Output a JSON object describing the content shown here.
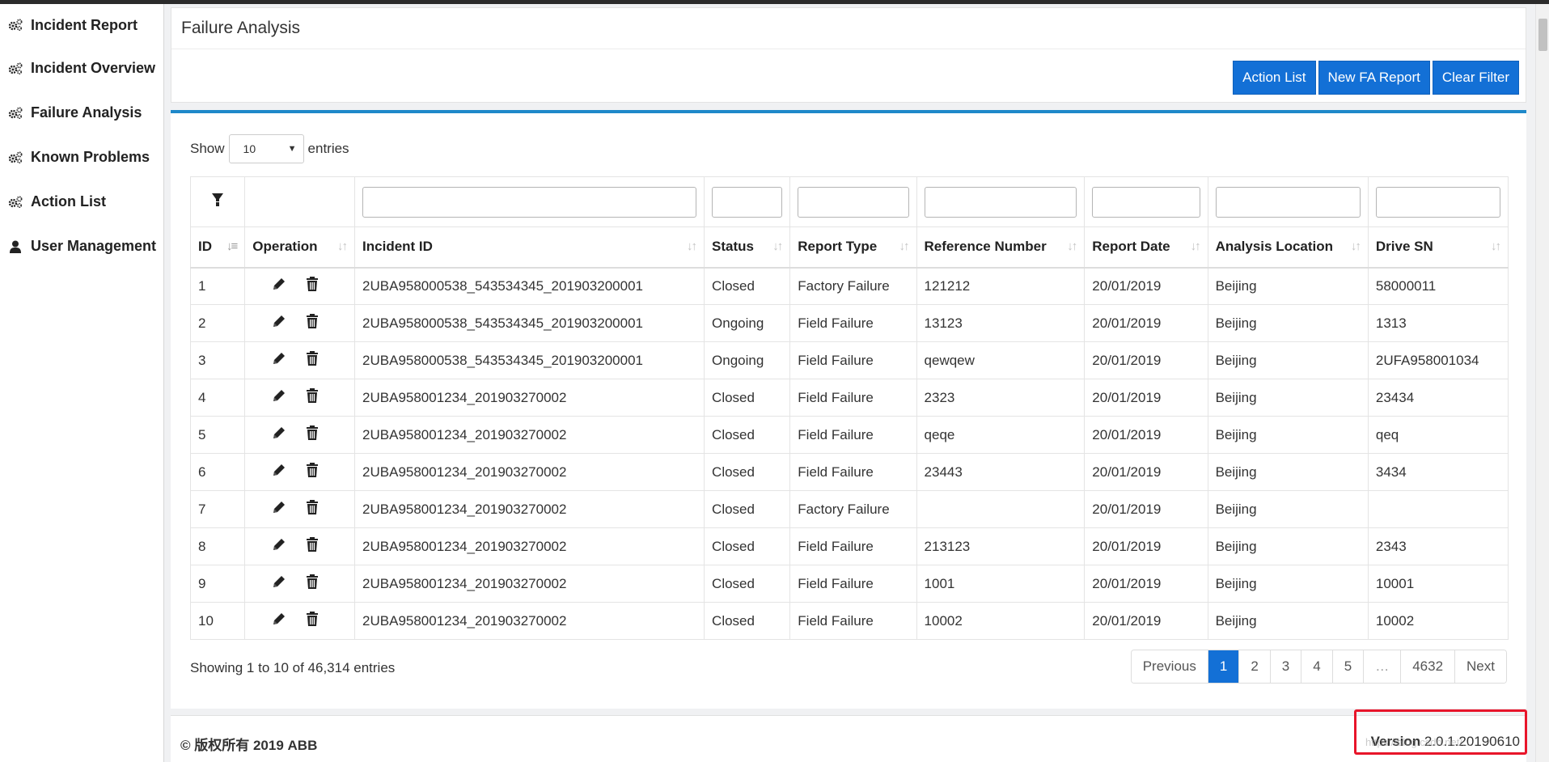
{
  "sidebar": {
    "items": [
      {
        "label": "Incident Report",
        "icon": "gears-icon"
      },
      {
        "label": "Incident Overview",
        "icon": "gears-icon"
      },
      {
        "label": "Failure Analysis",
        "icon": "gears-icon"
      },
      {
        "label": "Known Problems",
        "icon": "gears-icon"
      },
      {
        "label": "Action List",
        "icon": "gears-icon"
      },
      {
        "label": "User Management",
        "icon": "user-icon"
      }
    ]
  },
  "header": {
    "title": "Failure Analysis",
    "buttons": {
      "action_list": "Action List",
      "new_fa_report": "New FA Report",
      "clear_filter": "Clear Filter"
    }
  },
  "table": {
    "show_label": "Show",
    "page_size": "10",
    "entries_label": "entries",
    "columns": [
      "ID",
      "Operation",
      "Incident ID",
      "Status",
      "Report Type",
      "Reference Number",
      "Report Date",
      "Analysis Location",
      "Drive SN"
    ],
    "rows": [
      {
        "id": "1",
        "incident_id": "2UBA958000538_543534345_201903200001",
        "status": "Closed",
        "report_type": "Factory Failure",
        "reference": "121212",
        "date": "20/01/2019",
        "location": "Beijing",
        "drive_sn": "58000011"
      },
      {
        "id": "2",
        "incident_id": "2UBA958000538_543534345_201903200001",
        "status": "Ongoing",
        "report_type": "Field Failure",
        "reference": "13123",
        "date": "20/01/2019",
        "location": "Beijing",
        "drive_sn": "1313"
      },
      {
        "id": "3",
        "incident_id": "2UBA958000538_543534345_201903200001",
        "status": "Ongoing",
        "report_type": "Field Failure",
        "reference": "qewqew",
        "date": "20/01/2019",
        "location": "Beijing",
        "drive_sn": "2UFA958001034"
      },
      {
        "id": "4",
        "incident_id": "2UBA958001234_201903270002",
        "status": "Closed",
        "report_type": "Field Failure",
        "reference": "2323",
        "date": "20/01/2019",
        "location": "Beijing",
        "drive_sn": "23434"
      },
      {
        "id": "5",
        "incident_id": "2UBA958001234_201903270002",
        "status": "Closed",
        "report_type": "Field Failure",
        "reference": "qeqe",
        "date": "20/01/2019",
        "location": "Beijing",
        "drive_sn": "qeq"
      },
      {
        "id": "6",
        "incident_id": "2UBA958001234_201903270002",
        "status": "Closed",
        "report_type": "Field Failure",
        "reference": "23443",
        "date": "20/01/2019",
        "location": "Beijing",
        "drive_sn": "3434"
      },
      {
        "id": "7",
        "incident_id": "2UBA958001234_201903270002",
        "status": "Closed",
        "report_type": "Factory Failure",
        "reference": "",
        "date": "20/01/2019",
        "location": "Beijing",
        "drive_sn": ""
      },
      {
        "id": "8",
        "incident_id": "2UBA958001234_201903270002",
        "status": "Closed",
        "report_type": "Field Failure",
        "reference": "213123",
        "date": "20/01/2019",
        "location": "Beijing",
        "drive_sn": "2343"
      },
      {
        "id": "9",
        "incident_id": "2UBA958001234_201903270002",
        "status": "Closed",
        "report_type": "Field Failure",
        "reference": "1001",
        "date": "20/01/2019",
        "location": "Beijing",
        "drive_sn": "10001"
      },
      {
        "id": "10",
        "incident_id": "2UBA958001234_201903270002",
        "status": "Closed",
        "report_type": "Field Failure",
        "reference": "10002",
        "date": "20/01/2019",
        "location": "Beijing",
        "drive_sn": "10002"
      }
    ],
    "info": "Showing 1 to 10 of 46,314 entries"
  },
  "pagination": {
    "previous": "Previous",
    "pages": [
      "1",
      "2",
      "3",
      "4",
      "5",
      "…",
      "4632"
    ],
    "active": "1",
    "next": "Next"
  },
  "footer": {
    "copyright": "© 版权所有 2019 ABB",
    "version_label": "Version",
    "version_value": "2.0.1.20190610",
    "watermark": "https://blog.csdn.net/..."
  },
  "colors": {
    "primary": "#1370d6",
    "accent_bar": "#1e88c9",
    "highlight": "#e8152a"
  }
}
